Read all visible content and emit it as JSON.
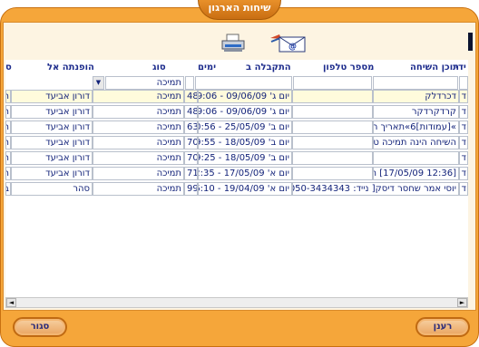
{
  "window": {
    "title": "שיחות הארגון"
  },
  "toolbar": {
    "print_icon": "printer-icon",
    "email_icon": "email-icon"
  },
  "grid": {
    "columns": [
      "ס",
      "הופנתה אל",
      "סוג",
      "ימים",
      "התקבלה ב",
      "מספר טלפון",
      "תוכן השיחה",
      "ל ידי"
    ],
    "filter": {
      "type_value": "תמיכה"
    },
    "rows": [
      {
        "c0": "ח",
        "assignee": "דורון אביעד",
        "type": "תמיכה",
        "days": "48",
        "received": "יום ג' 09/06/09 - 09:06",
        "phone": "",
        "content": "דכרדלק",
        "by": "ד"
      },
      {
        "c0": "ח",
        "assignee": "דורון אביעד",
        "type": "תמיכה",
        "days": "48",
        "received": "יום ג' 09/06/09 - 09:06",
        "phone": "",
        "content": "קרדקרדקר",
        "by": "ד"
      },
      {
        "c0": "ח",
        "assignee": "דורון אביעד",
        "type": "תמיכה",
        "days": "63",
        "received": "יום ב' 25/05/09 - 10:56",
        "phone": "",
        "content": "»[עמודות]6»תאריך הכ",
        "by": "ד"
      },
      {
        "c0": "ח",
        "assignee": "דורון אביעד",
        "type": "תמיכה",
        "days": "70",
        "received": "יום ב' 18/05/09 - 09:55",
        "phone": "",
        "content": "השיחה הינה תמיכה טכ",
        "by": "ד"
      },
      {
        "c0": "ח",
        "assignee": "דורון אביעד",
        "type": "תמיכה",
        "days": "70",
        "received": "יום ב' 18/05/09 - 09:25",
        "phone": "",
        "content": "",
        "by": "ד"
      },
      {
        "c0": "ח",
        "assignee": "דורון אביעד",
        "type": "תמיכה",
        "days": "71",
        "received": "יום א' 17/05/09 - 12:35",
        "phone": "",
        "content": "[12:36 17/05/09] ת",
        "by": "ד"
      },
      {
        "c0": "ב",
        "assignee": "סהר",
        "type": "תמיכה",
        "days": "99",
        "received": "יום א' 19/04/09 - 16:10",
        "phone": "",
        "content": "יוסי אמר שחסר דיסק[ נייד: 050-3434343 ]",
        "by": "ד"
      }
    ]
  },
  "buttons": {
    "close": "סגור",
    "refresh": "רענן"
  },
  "colors": {
    "frame": "#f5a63a",
    "panel": "#fdf4e2",
    "header_text": "#1c2b8c",
    "selected_row": "#fffbdc"
  }
}
